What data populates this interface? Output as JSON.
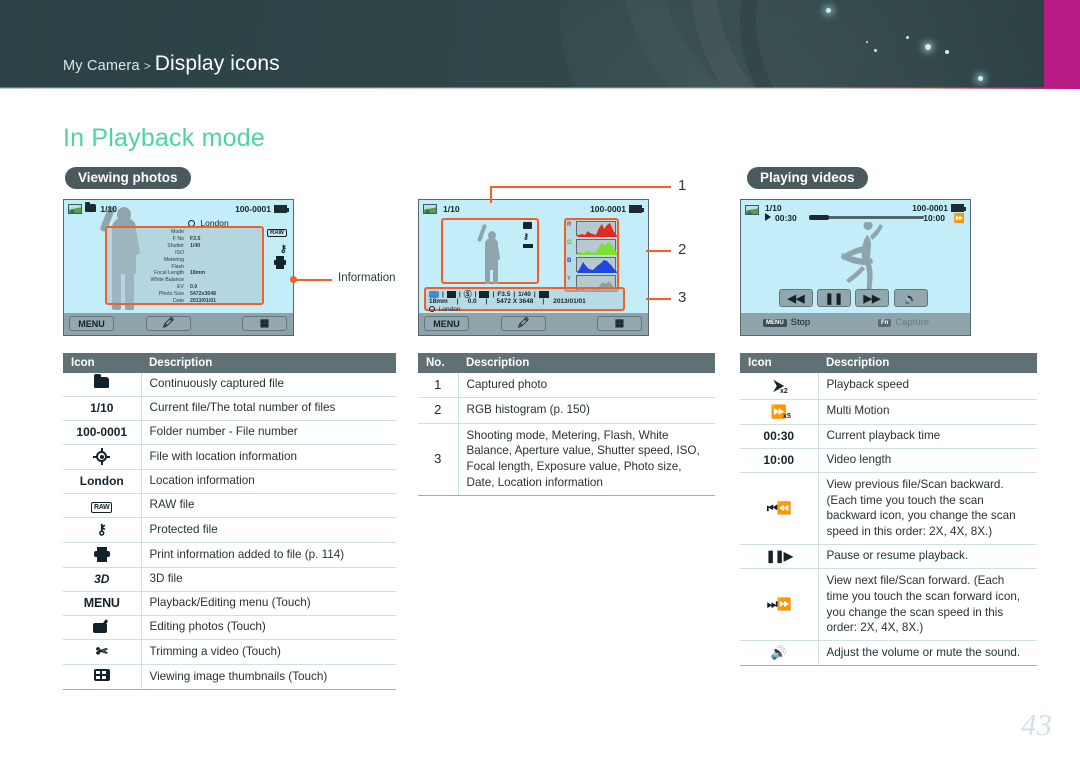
{
  "header": {
    "breadcrumb_parent": "My Camera",
    "breadcrumb_separator": ">",
    "breadcrumb_current": "Display icons",
    "accent_magenta": "#b81b84",
    "background": "#2e4448"
  },
  "page": {
    "title": "In Playback mode",
    "title_color": "#4dd4a0",
    "page_number": "43"
  },
  "sections": {
    "viewing_photos": "Viewing photos",
    "playing_videos": "Playing videos"
  },
  "callouts": {
    "information_label": "Information",
    "numbers": [
      "1",
      "2",
      "3"
    ],
    "leader_color": "#f0612a"
  },
  "screen_photo": {
    "file_index": "1/10",
    "file_number": "100-0001",
    "location": "London",
    "info_rows": [
      {
        "label": "Mode",
        "value": ""
      },
      {
        "label": "F No",
        "value": "F3.5"
      },
      {
        "label": "Shutter",
        "value": "1/40"
      },
      {
        "label": "ISO",
        "value": ""
      },
      {
        "label": "Metering",
        "value": ""
      },
      {
        "label": "Flash",
        "value": ""
      },
      {
        "label": "Focal Length",
        "value": "18mm"
      },
      {
        "label": "White Balance",
        "value": ""
      },
      {
        "label": "EV",
        "value": "0.0"
      },
      {
        "label": "Photo Size",
        "value": "5472x3648"
      },
      {
        "label": "Date",
        "value": "2013/01/01"
      }
    ],
    "bottom_menu": "MENU"
  },
  "screen_histogram": {
    "file_index": "1/10",
    "file_number": "100-0001",
    "histogram_labels": [
      "R",
      "G",
      "B",
      "Y"
    ],
    "histogram_colors": [
      "#e02b20",
      "#7ae038",
      "#2048e0",
      "#9a9a9a"
    ],
    "info_line1": [
      "F3.5",
      "1/40"
    ],
    "info_line2": [
      "18mm",
      "0.0",
      "5472 X 3648",
      "2013/01/01"
    ],
    "location": "London",
    "bottom_menu": "MENU"
  },
  "screen_video": {
    "file_index": "1/10",
    "file_number": "100-0001",
    "current_time": "00:30",
    "total_time": "10:00",
    "btn_stop_key": "MENU",
    "btn_stop_label": "Stop",
    "btn_capture_key": "Fn",
    "btn_capture_label": "Capture"
  },
  "table_photo": {
    "headers": [
      "Icon",
      "Description"
    ],
    "rows": [
      {
        "icon": "continuous-folder-icon",
        "icon_text": "",
        "desc": "Continuously captured file"
      },
      {
        "icon": "file-index-text",
        "icon_text": "1/10",
        "desc": "Current file/The total number of files"
      },
      {
        "icon": "file-number-text",
        "icon_text": "100-0001",
        "desc": "Folder number - File number"
      },
      {
        "icon": "gps-icon",
        "icon_text": "",
        "desc": "File with location information"
      },
      {
        "icon": "location-text",
        "icon_text": "London",
        "desc": "Location information"
      },
      {
        "icon": "raw-icon",
        "icon_text": "RAW",
        "desc": "RAW file"
      },
      {
        "icon": "lock-icon",
        "icon_text": "",
        "desc": "Protected file"
      },
      {
        "icon": "printer-icon",
        "icon_text": "",
        "desc": "Print information added to file (p. 114)"
      },
      {
        "icon": "3d-icon",
        "icon_text": "3D",
        "desc": "3D file"
      },
      {
        "icon": "menu-icon",
        "icon_text": "MENU",
        "desc": "Playback/Editing menu (Touch)"
      },
      {
        "icon": "edit-photo-icon",
        "icon_text": "",
        "desc": "Editing photos (Touch)"
      },
      {
        "icon": "trim-video-icon",
        "icon_text": "",
        "desc": "Trimming a video (Touch)"
      },
      {
        "icon": "thumbnails-icon",
        "icon_text": "",
        "desc": "Viewing image thumbnails (Touch)"
      }
    ]
  },
  "table_histogram": {
    "headers": [
      "No.",
      "Description"
    ],
    "rows": [
      {
        "no": "1",
        "desc": "Captured photo"
      },
      {
        "no": "2",
        "desc": "RGB histogram (p. 150)"
      },
      {
        "no": "3",
        "desc": "Shooting mode, Metering, Flash, White Balance, Aperture value, Shutter speed, ISO, Focal length, Exposure value, Photo size, Date, Location information"
      }
    ]
  },
  "table_video": {
    "headers": [
      "Icon",
      "Description"
    ],
    "rows": [
      {
        "icon": "playback-speed-icon",
        "icon_text": "",
        "desc": "Playback speed"
      },
      {
        "icon": "multi-motion-icon",
        "icon_text": "",
        "desc": "Multi Motion"
      },
      {
        "icon": "current-time-text",
        "icon_text": "00:30",
        "desc": "Current playback time"
      },
      {
        "icon": "video-length-text",
        "icon_text": "10:00",
        "desc": "Video length"
      },
      {
        "icon": "scan-backward-icon",
        "icon_text": "",
        "desc": "View previous file/Scan backward. (Each time you touch the scan backward icon, you change the scan speed in this order: 2X, 4X, 8X.)"
      },
      {
        "icon": "pause-resume-icon",
        "icon_text": "",
        "desc": "Pause or resume playback."
      },
      {
        "icon": "scan-forward-icon",
        "icon_text": "",
        "desc": "View next file/Scan forward. (Each time you touch the scan forward icon, you change the scan speed in this order: 2X, 4X, 8X.)"
      },
      {
        "icon": "volume-icon",
        "icon_text": "",
        "desc": "Adjust the volume or mute the sound."
      }
    ]
  }
}
